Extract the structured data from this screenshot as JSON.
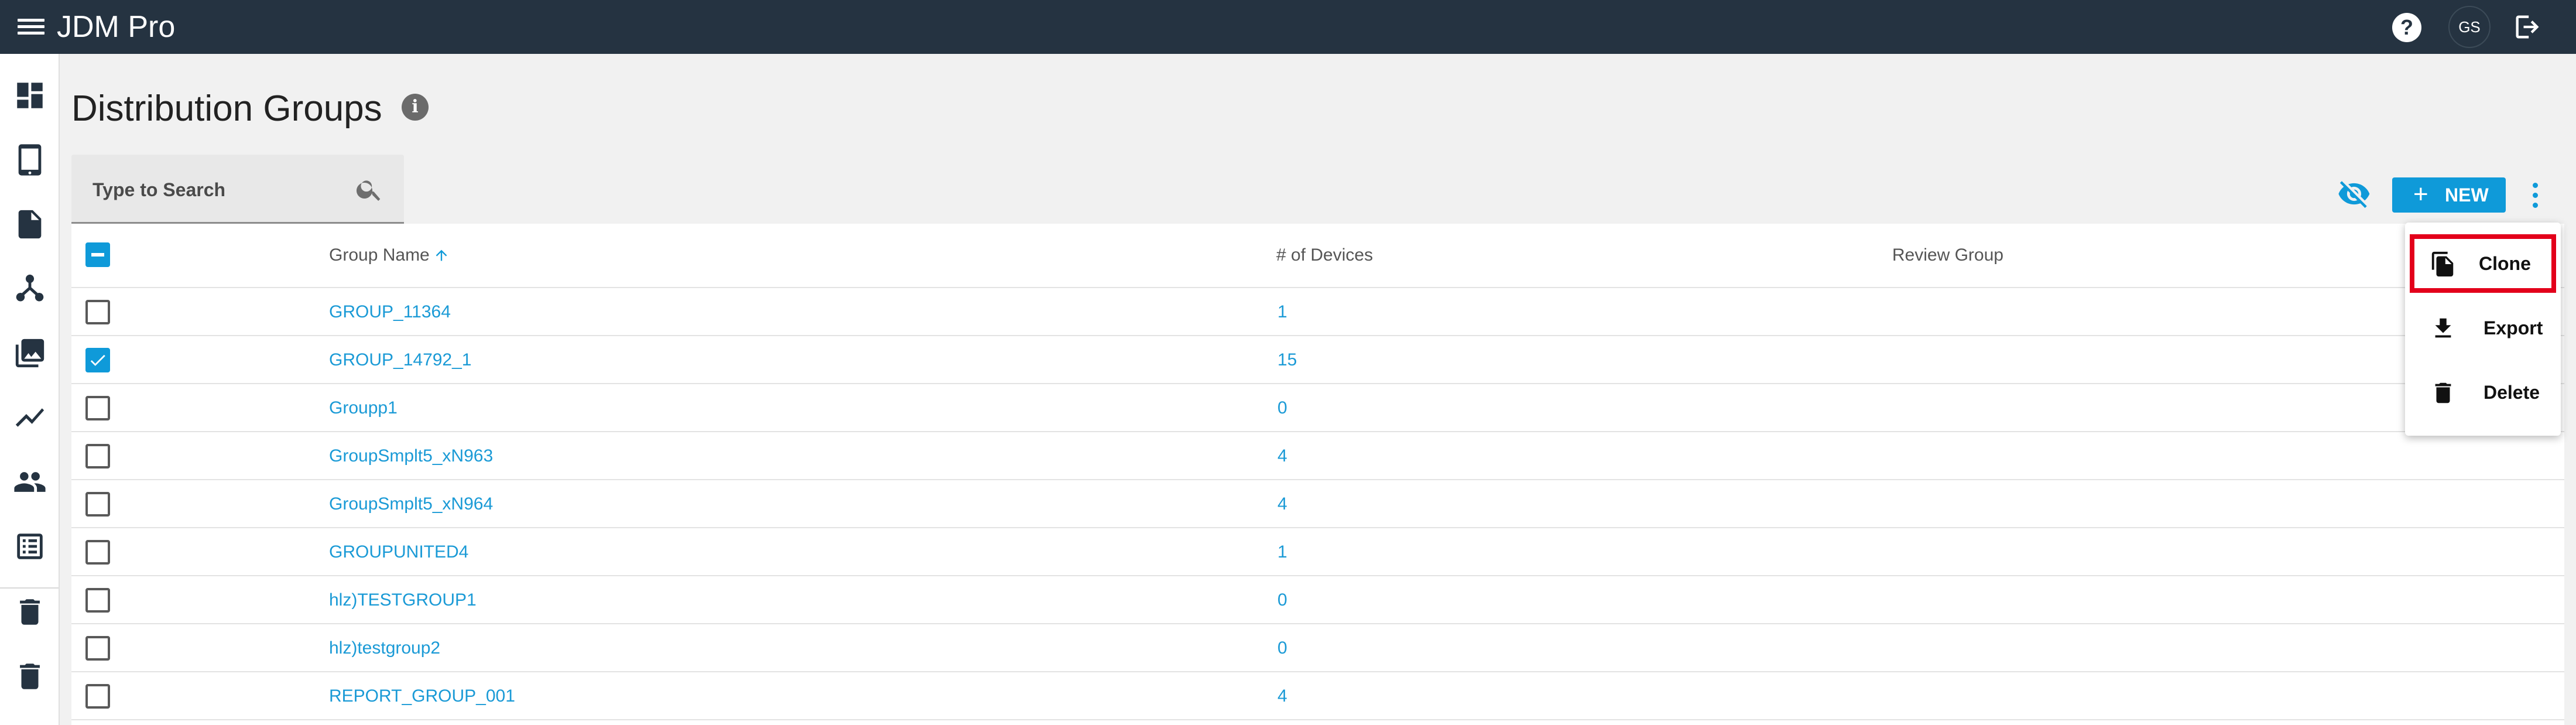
{
  "app": {
    "title": "JDM Pro",
    "avatar_initials": "GS",
    "help_label": "?"
  },
  "sidebar": {
    "items": [
      {
        "icon": "dashboard-icon"
      },
      {
        "icon": "tablet-icon"
      },
      {
        "icon": "document-icon"
      },
      {
        "icon": "hierarchy-icon"
      },
      {
        "icon": "gallery-icon"
      },
      {
        "icon": "trending-icon"
      },
      {
        "icon": "people-icon"
      },
      {
        "icon": "list-icon"
      },
      {
        "icon": "trash-icon"
      },
      {
        "icon": "trash-icon"
      }
    ]
  },
  "page": {
    "title": "Distribution Groups",
    "info_label": "i"
  },
  "search": {
    "placeholder": "Type to Search"
  },
  "toolbar": {
    "new_label": "NEW",
    "new_plus": "+"
  },
  "table": {
    "columns": [
      "Group Name",
      "# of Devices",
      "Review Group"
    ],
    "rows": [
      {
        "name": "GROUP_11364",
        "devices": "1",
        "checked": false
      },
      {
        "name": "GROUP_14792_1",
        "devices": "15",
        "checked": true
      },
      {
        "name": "Groupp1",
        "devices": "0",
        "checked": false
      },
      {
        "name": "GroupSmplt5_xN963",
        "devices": "4",
        "checked": false
      },
      {
        "name": "GroupSmplt5_xN964",
        "devices": "4",
        "checked": false
      },
      {
        "name": "GROUPUNITED4",
        "devices": "1",
        "checked": false
      },
      {
        "name": "hlz)TESTGROUP1",
        "devices": "0",
        "checked": false
      },
      {
        "name": "hlz)testgroup2",
        "devices": "0",
        "checked": false
      },
      {
        "name": "REPORT_GROUP_001",
        "devices": "4",
        "checked": false
      }
    ]
  },
  "menu": {
    "items": [
      {
        "label": "Clone",
        "icon": "copy-icon"
      },
      {
        "label": "Export",
        "icon": "download-icon"
      },
      {
        "label": "Delete",
        "icon": "trash-icon"
      }
    ]
  },
  "colors": {
    "topbar": "#253341",
    "accent": "#0f9ad9",
    "link": "#1a9ad6",
    "highlight": "#e3001b"
  }
}
